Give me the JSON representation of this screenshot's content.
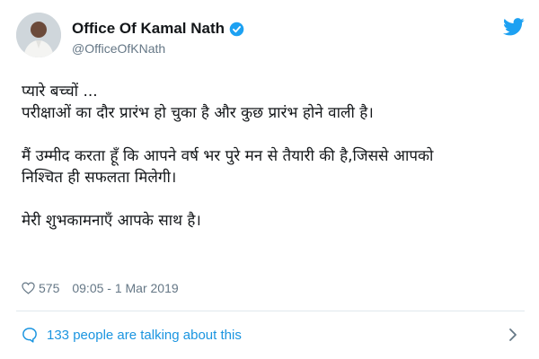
{
  "author": {
    "display_name": "Office Of Kamal Nath",
    "handle": "@OfficeOfKNath",
    "verified": true
  },
  "tweet": {
    "lines": [
      "प्यारे बच्चों ...",
      "परीक्षाओं का दौर प्रारंभ हो चुका है और कुछ प्रारंभ होने वाली है।",
      "",
      "मैं उम्मीद करता हूँ कि आपने वर्ष भर पुरे मन से तैयारी की है,जिससे आपको",
      "निश्चित ही सफलता मिलेगी।",
      "",
      "मेरी शुभकामनाएँ आपके साथ है।"
    ]
  },
  "meta": {
    "like_count": "575",
    "timestamp": "09:05 - 1 Mar 2019"
  },
  "footer": {
    "talking_text": "133 people are talking about this"
  },
  "icons": {
    "verified": "verified-badge-icon",
    "brand": "twitter-bird-icon",
    "like": "heart-icon",
    "talking": "speech-bubble-icon",
    "more": "chevron-right-icon"
  },
  "colors": {
    "brand_blue": "#1da1f2",
    "link_blue": "#1b95e0",
    "secondary_text": "#657786",
    "primary_text": "#14171a",
    "divider": "#e1e8ed"
  }
}
